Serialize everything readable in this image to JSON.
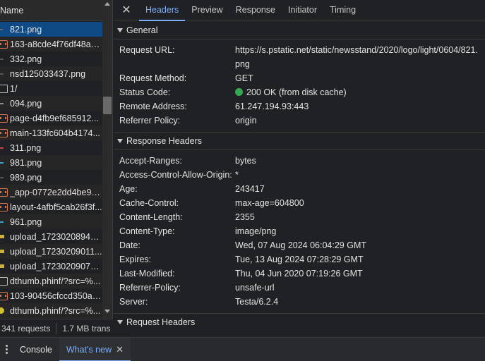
{
  "network": {
    "column_name": "Name",
    "rows": [
      {
        "name": "821.png",
        "icon": "image-icon",
        "selected": true
      },
      {
        "name": "163-a8cde4f76df48ac...",
        "icon": "document-icon"
      },
      {
        "name": "332.png",
        "icon": "image-icon"
      },
      {
        "name": "nsd125033437.png",
        "icon": "image-icon"
      },
      {
        "name": "1/",
        "icon": "page-icon"
      },
      {
        "name": "094.png",
        "icon": "image-icon"
      },
      {
        "name": "page-d4fb9ef685912...",
        "icon": "document-icon"
      },
      {
        "name": "main-133fc604b4174...",
        "icon": "document-icon"
      },
      {
        "name": "311.png",
        "icon": "image-icon"
      },
      {
        "name": "981.png",
        "icon": "image-icon"
      },
      {
        "name": "989.png",
        "icon": "image-icon"
      },
      {
        "name": "_app-0772e2dd4be9a...",
        "icon": "document-icon"
      },
      {
        "name": "layout-4afbf5cab26f3f...",
        "icon": "document-icon"
      },
      {
        "name": "961.png",
        "icon": "image-icon"
      },
      {
        "name": "upload_17230208949...",
        "icon": "image-icon"
      },
      {
        "name": "upload_17230209011...",
        "icon": "image-icon"
      },
      {
        "name": "upload_17230209075...",
        "icon": "image-icon"
      },
      {
        "name": "dthumb.phinf/?src=%...",
        "icon": "page-icon"
      },
      {
        "name": "103-90456cfccd350aa...",
        "icon": "document-icon"
      },
      {
        "name": "dthumb.phinf/?src=%...",
        "icon": "image-icon"
      }
    ],
    "status": {
      "requests": "341 requests",
      "transferred": "1.7 MB trans"
    }
  },
  "details": {
    "tabs": [
      "Headers",
      "Preview",
      "Response",
      "Initiator",
      "Timing"
    ],
    "active_tab": "Headers",
    "general": {
      "title": "General",
      "rows": [
        {
          "key": "Request URL:",
          "value": "https://s.pstatic.net/static/newsstand/2020/logo/light/0604/821.png"
        },
        {
          "key": "Request Method:",
          "value": "GET"
        },
        {
          "key": "Status Code:",
          "value": "200 OK (from disk cache)"
        },
        {
          "key": "Remote Address:",
          "value": "61.247.194.93:443"
        },
        {
          "key": "Referrer Policy:",
          "value": "origin"
        }
      ]
    },
    "response_headers": {
      "title": "Response Headers",
      "rows": [
        {
          "key": "Accept-Ranges:",
          "value": "bytes"
        },
        {
          "key": "Access-Control-Allow-Origin:",
          "value": "*"
        },
        {
          "key": "Age:",
          "value": "243417"
        },
        {
          "key": "Cache-Control:",
          "value": "max-age=604800"
        },
        {
          "key": "Content-Length:",
          "value": "2355"
        },
        {
          "key": "Content-Type:",
          "value": "image/png"
        },
        {
          "key": "Date:",
          "value": "Wed, 07 Aug 2024 06:04:29 GMT"
        },
        {
          "key": "Expires:",
          "value": "Tue, 13 Aug 2024 07:28:29 GMT"
        },
        {
          "key": "Last-Modified:",
          "value": "Thu, 04 Jun 2020 07:19:26 GMT"
        },
        {
          "key": "Referrer-Policy:",
          "value": "unsafe-url"
        },
        {
          "key": "Server:",
          "value": "Testa/6.2.4"
        }
      ]
    },
    "request_headers": {
      "title": "Request Headers"
    }
  },
  "drawer": {
    "tabs": [
      "Console",
      "What's new"
    ],
    "active_tab": "What's new"
  },
  "colors": {
    "accent": "#7cacf8",
    "selected_row": "#0f4a85",
    "status_ok": "#34a853"
  }
}
